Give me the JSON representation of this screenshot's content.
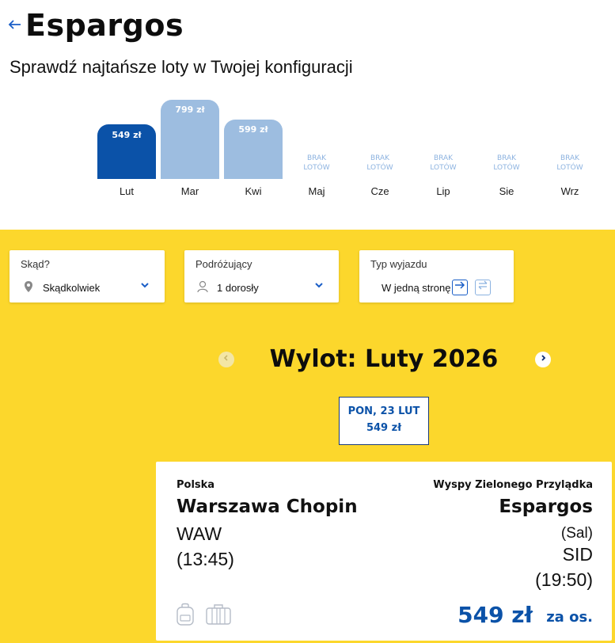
{
  "header": {
    "back_icon": "arrow-left-icon",
    "title": "Espargos",
    "subtitle": "Sprawdź najtańsze loty w Twojej konfiguracji"
  },
  "price_chart": {
    "months": [
      {
        "label": "Lut",
        "price": 549,
        "price_label": "549 zł",
        "selected": true
      },
      {
        "label": "Mar",
        "price": 799,
        "price_label": "799 zł",
        "selected": false
      },
      {
        "label": "Kwi",
        "price": 599,
        "price_label": "599 zł",
        "selected": false
      },
      {
        "label": "Maj",
        "price": null,
        "no_flights_label": "BRAK LOTÓW"
      },
      {
        "label": "Cze",
        "price": null,
        "no_flights_label": "BRAK LOTÓW"
      },
      {
        "label": "Lip",
        "price": null,
        "no_flights_label": "BRAK LOTÓW"
      },
      {
        "label": "Sie",
        "price": null,
        "no_flights_label": "BRAK LOTÓW"
      },
      {
        "label": "Wrz",
        "price": null,
        "no_flights_label": "BRAK LOTÓW"
      }
    ],
    "colors": {
      "selected": "#0b52a8",
      "default": "#9dbde0"
    }
  },
  "filters": {
    "from": {
      "label": "Skąd?",
      "value": "Skądkolwiek",
      "icon": "location-pin-icon"
    },
    "travelers": {
      "label": "Podróżujący",
      "value": "1 dorosły",
      "icon": "person-icon"
    },
    "trip_type": {
      "label": "Typ wyjazdu",
      "value": "W jedną stronę",
      "one_way_icon": "arrow-right-icon",
      "round_trip_icon": "swap-arrows-icon"
    }
  },
  "calendar": {
    "title": "Wylot: Luty 2026",
    "prev_icon": "chevron-left-icon",
    "next_icon": "chevron-right-icon",
    "selected_day": {
      "date": "PON, 23 LUT",
      "price": "549 zł"
    }
  },
  "flight": {
    "origin": {
      "country": "Polska",
      "city": "Warszawa Chopin",
      "code": "WAW",
      "time": "(13:45)"
    },
    "destination": {
      "country": "Wyspy Zielonego Przylądka",
      "city": "Espargos",
      "region": "(Sal)",
      "code": "SID",
      "time": "(19:50)"
    },
    "price": "549 zł",
    "per_person": "za os.",
    "icons": [
      "backpack-icon",
      "suitcase-icon"
    ]
  },
  "accent_color": "#0b52a8",
  "panel_color": "#fcd72c"
}
